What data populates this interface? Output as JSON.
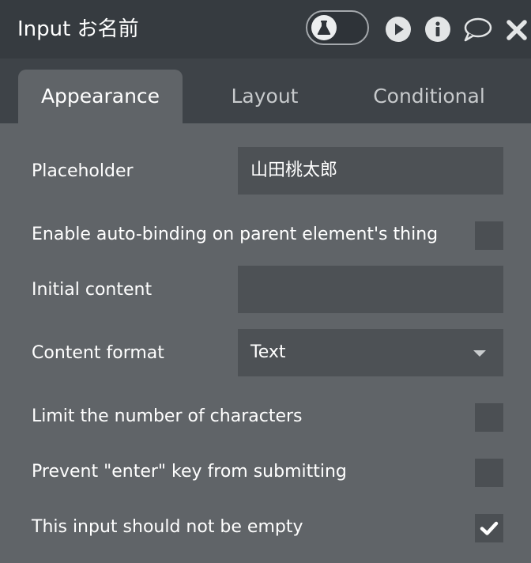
{
  "header": {
    "title": "Input お名前",
    "icons": [
      "flask-icon",
      "play-icon",
      "info-icon",
      "comment-icon",
      "close-icon"
    ]
  },
  "tabs": [
    {
      "label": "Appearance",
      "active": true
    },
    {
      "label": "Layout",
      "active": false
    },
    {
      "label": "Conditional",
      "active": false
    }
  ],
  "fields": {
    "placeholder": {
      "label": "Placeholder",
      "value": "山田桃太郎"
    },
    "auto_binding": {
      "label": "Enable auto-binding on parent element's thing",
      "checked": false
    },
    "initial_content": {
      "label": "Initial content",
      "value": ""
    },
    "content_format": {
      "label": "Content format",
      "value": "Text"
    },
    "limit_chars": {
      "label": "Limit the number of characters",
      "checked": false
    },
    "prevent_enter": {
      "label": "Prevent \"enter\" key from submitting",
      "checked": false
    },
    "not_empty": {
      "label": "This input should not be empty",
      "checked": true
    }
  },
  "colors": {
    "header_bg": "#363b40",
    "tabbar_bg": "#3e4348",
    "panel_bg": "#606468",
    "field_bg": "#4d5155"
  }
}
